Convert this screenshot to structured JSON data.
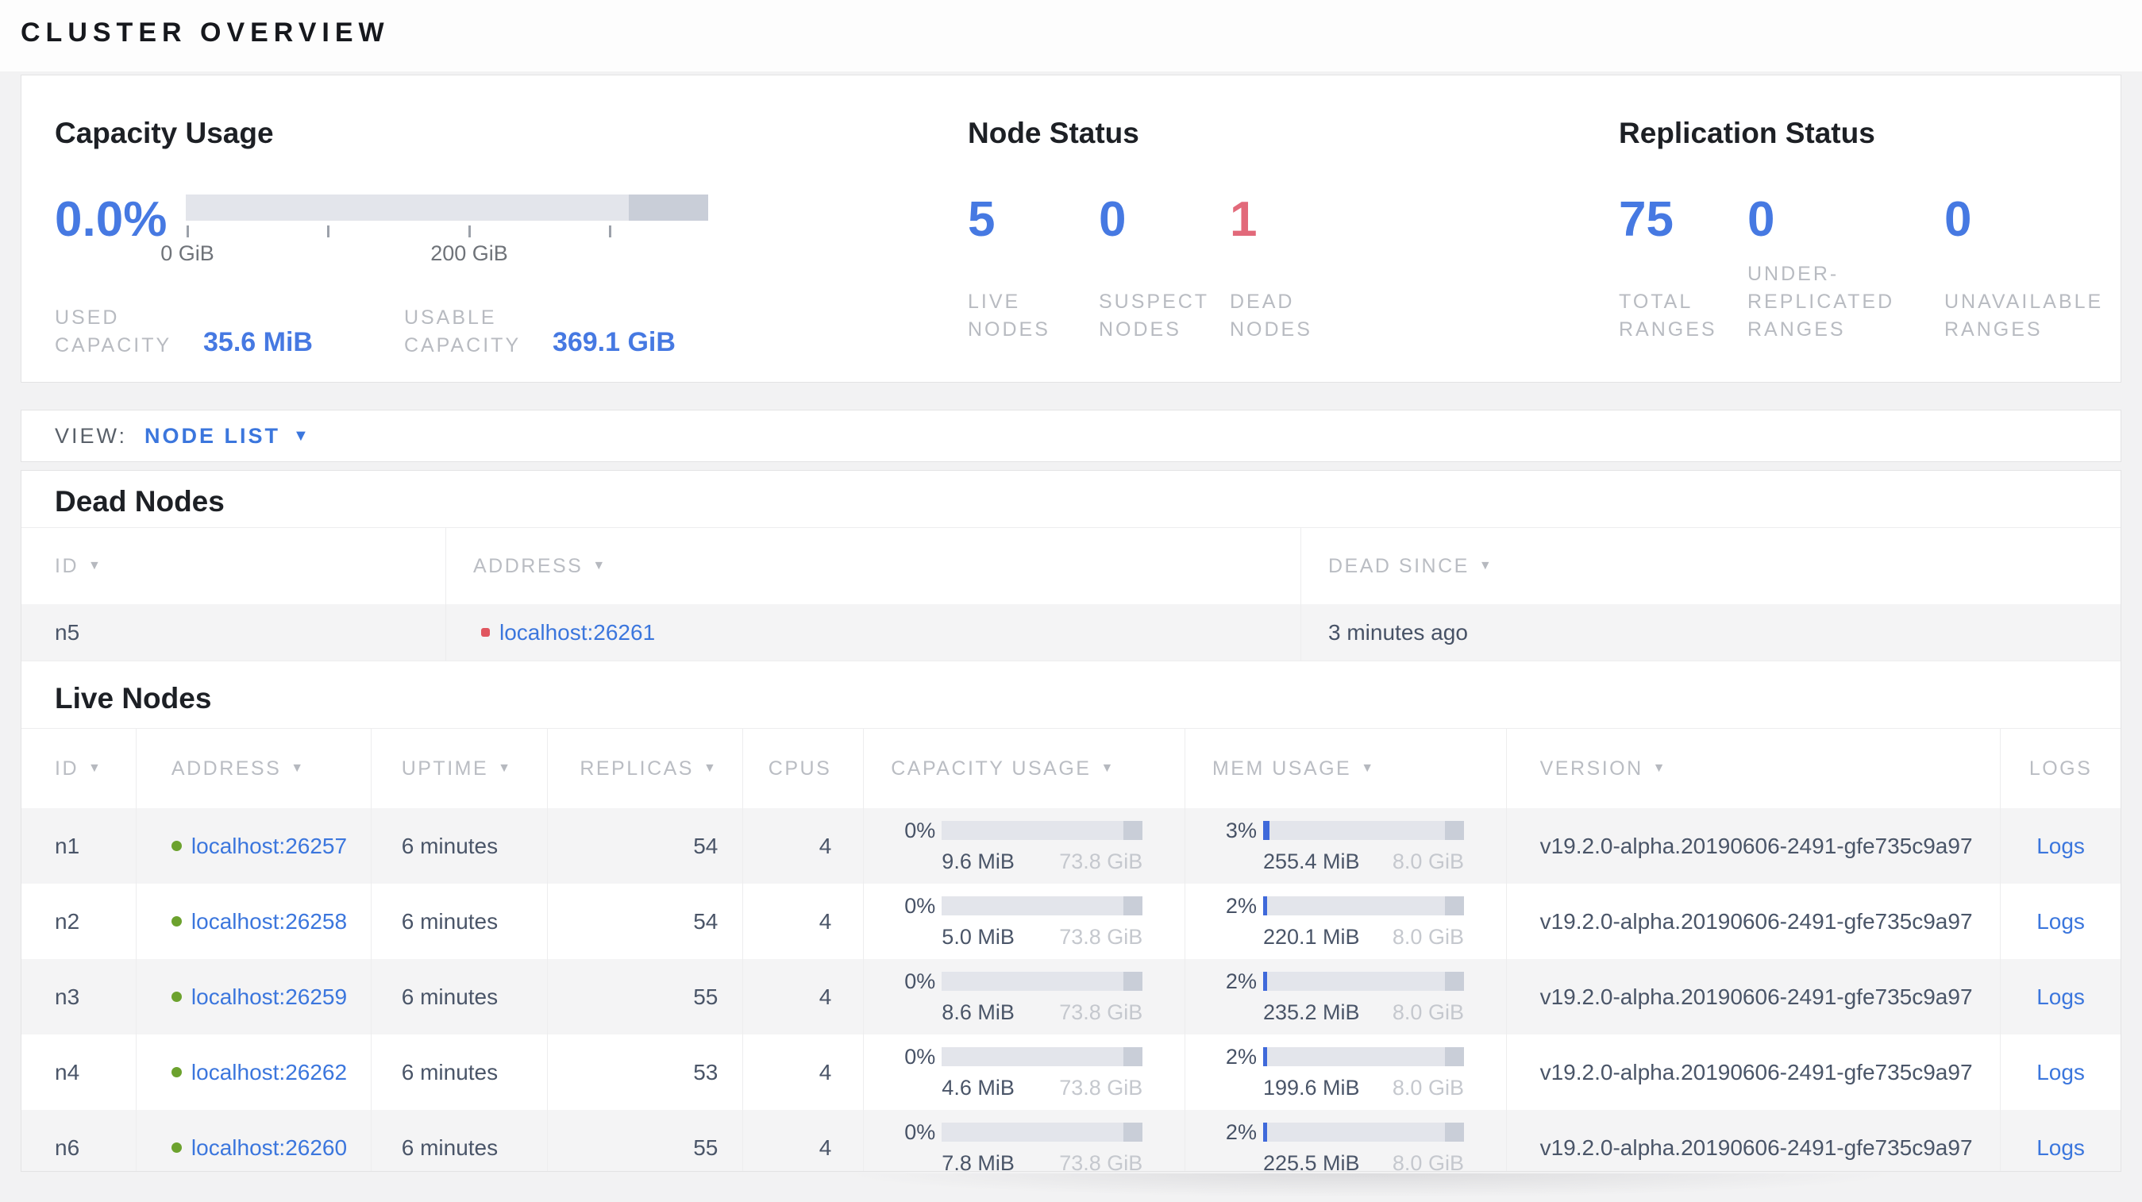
{
  "page_title": "CLUSTER OVERVIEW",
  "colors": {
    "accent_blue": "#4679e2",
    "link_blue": "#3b76dd",
    "danger_red": "#e2697a",
    "live_green": "#6ca22e",
    "dead_dot_red": "#e0565f"
  },
  "summary": {
    "capacity": {
      "title": "Capacity Usage",
      "percent": "0.0%",
      "tick_labels": [
        "0 GiB",
        "200 GiB"
      ],
      "stats": [
        {
          "label": "USED CAPACITY",
          "value": "35.6 MiB"
        },
        {
          "label": "USABLE CAPACITY",
          "value": "369.1 GiB"
        }
      ]
    },
    "node_status": {
      "title": "Node Status",
      "stats": [
        {
          "value": "5",
          "label": "LIVE NODES"
        },
        {
          "value": "0",
          "label": "SUSPECT NODES"
        },
        {
          "value": "1",
          "label": "DEAD NODES"
        }
      ]
    },
    "replication": {
      "title": "Replication Status",
      "stats": [
        {
          "value": "75",
          "label": "TOTAL RANGES"
        },
        {
          "value": "0",
          "label": "UNDER-REPLICATED RANGES"
        },
        {
          "value": "0",
          "label": "UNAVAILABLE RANGES"
        }
      ]
    }
  },
  "view_bar": {
    "label": "VIEW:",
    "selected": "NODE LIST",
    "caret": "▼"
  },
  "dead_nodes": {
    "title": "Dead Nodes",
    "columns": [
      {
        "label": "ID"
      },
      {
        "label": "ADDRESS"
      },
      {
        "label": "DEAD SINCE"
      }
    ],
    "sort_caret": "▼",
    "rows": [
      {
        "id": "n5",
        "address": "localhost:26261",
        "dead_since": "3 minutes ago"
      }
    ]
  },
  "live_nodes": {
    "title": "Live Nodes",
    "columns": [
      {
        "label": "ID"
      },
      {
        "label": "ADDRESS"
      },
      {
        "label": "UPTIME"
      },
      {
        "label": "REPLICAS"
      },
      {
        "label": "CPUS"
      },
      {
        "label": "CAPACITY USAGE"
      },
      {
        "label": "MEM USAGE"
      },
      {
        "label": "VERSION"
      },
      {
        "label": "LOGS"
      }
    ],
    "sort_caret": "▼",
    "rows": [
      {
        "id": "n1",
        "address": "localhost:26257",
        "uptime": "6 minutes",
        "replicas": "54",
        "cpus": "4",
        "capacity_pct": "0%",
        "capacity_used": "9.6 MiB",
        "capacity_total": "73.8 GiB",
        "mem_pct": "3%",
        "mem_used": "255.4 MiB",
        "mem_total": "8.0 GiB",
        "version": "v19.2.0-alpha.20190606-2491-gfe735c9a97",
        "logs": "Logs"
      },
      {
        "id": "n2",
        "address": "localhost:26258",
        "uptime": "6 minutes",
        "replicas": "54",
        "cpus": "4",
        "capacity_pct": "0%",
        "capacity_used": "5.0 MiB",
        "capacity_total": "73.8 GiB",
        "mem_pct": "2%",
        "mem_used": "220.1 MiB",
        "mem_total": "8.0 GiB",
        "version": "v19.2.0-alpha.20190606-2491-gfe735c9a97",
        "logs": "Logs"
      },
      {
        "id": "n3",
        "address": "localhost:26259",
        "uptime": "6 minutes",
        "replicas": "55",
        "cpus": "4",
        "capacity_pct": "0%",
        "capacity_used": "8.6 MiB",
        "capacity_total": "73.8 GiB",
        "mem_pct": "2%",
        "mem_used": "235.2 MiB",
        "mem_total": "8.0 GiB",
        "version": "v19.2.0-alpha.20190606-2491-gfe735c9a97",
        "logs": "Logs"
      },
      {
        "id": "n4",
        "address": "localhost:26262",
        "uptime": "6 minutes",
        "replicas": "53",
        "cpus": "4",
        "capacity_pct": "0%",
        "capacity_used": "4.6 MiB",
        "capacity_total": "73.8 GiB",
        "mem_pct": "2%",
        "mem_used": "199.6 MiB",
        "mem_total": "8.0 GiB",
        "version": "v19.2.0-alpha.20190606-2491-gfe735c9a97",
        "logs": "Logs"
      },
      {
        "id": "n6",
        "address": "localhost:26260",
        "uptime": "6 minutes",
        "replicas": "55",
        "cpus": "4",
        "capacity_pct": "0%",
        "capacity_used": "7.8 MiB",
        "capacity_total": "73.8 GiB",
        "mem_pct": "2%",
        "mem_used": "225.5 MiB",
        "mem_total": "8.0 GiB",
        "version": "v19.2.0-alpha.20190606-2491-gfe735c9a97",
        "logs": "Logs"
      }
    ]
  }
}
